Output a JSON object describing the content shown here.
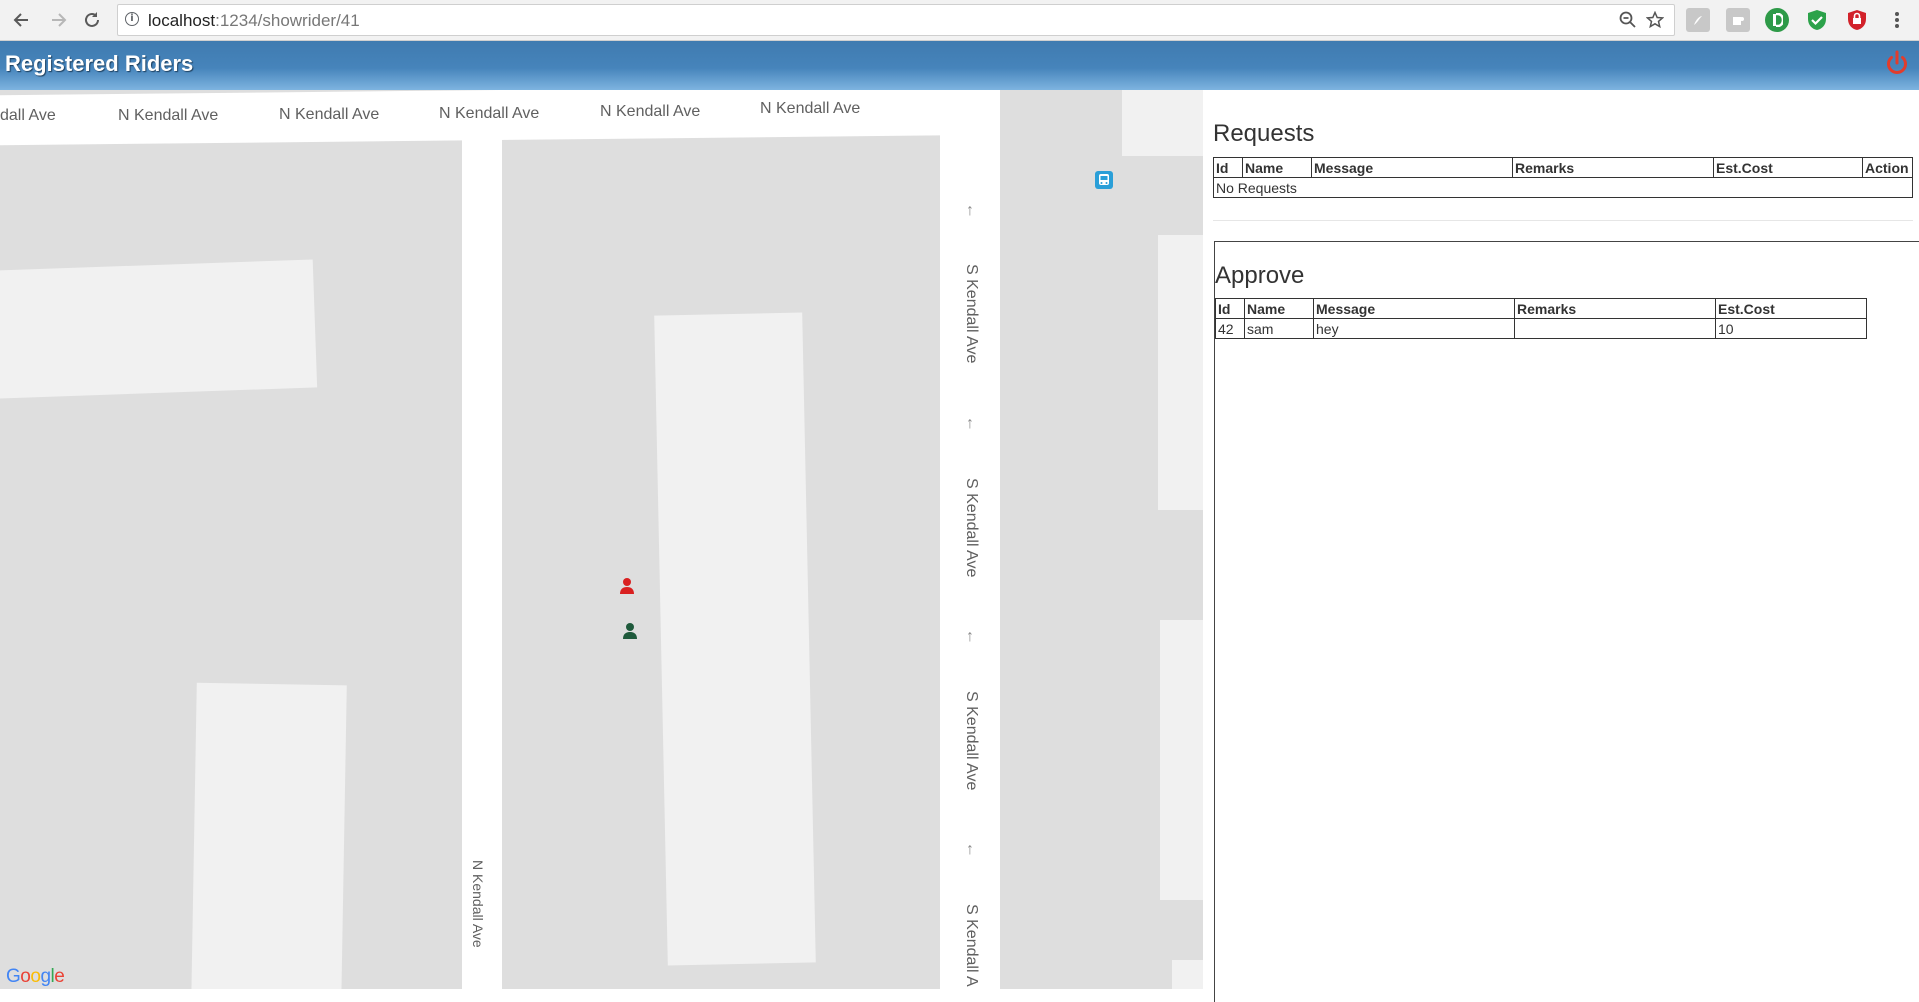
{
  "browser": {
    "url_host": "localhost",
    "url_path": ":1234/showrider/41",
    "icons": [
      "back-icon",
      "forward-icon",
      "reload-icon",
      "info-icon",
      "zoom-out-icon",
      "star-icon"
    ],
    "extensions": [
      "pdf-extension-icon",
      "puzzle-extension-icon",
      "readability-extension-icon",
      "shield-extension-icon",
      "adblock-extension-icon",
      "menu-icon"
    ],
    "colors": {
      "ext_green": "#2e9a48",
      "ext_shield": "#2ca24a",
      "ext_red": "#d2222a",
      "ext_gray": "#b7b7b7"
    }
  },
  "app": {
    "title": "Registered Riders",
    "power_icon": "power-icon",
    "colors": {
      "header_top": "#3f7bb0",
      "header_bottom": "#7eb4e0",
      "power": "#e23c2c"
    }
  },
  "map": {
    "street_top_labels": [
      "dall Ave",
      "N Kendall Ave",
      "N Kendall Ave",
      "N Kendall Ave",
      "N Kendall Ave",
      "N Kendall Ave"
    ],
    "street_right_labels": [
      "S Kendall Ave",
      "S Kendall Ave",
      "S Kendall Ave",
      "S Kendall A"
    ],
    "street_vertical_label": "N Kendall Ave",
    "markers": [
      "rider-marker-icon",
      "driver-marker-icon"
    ],
    "poi": "bus-stop-icon",
    "attribution_letters": [
      "G",
      "o",
      "o",
      "g",
      "l",
      "e"
    ],
    "attribution_colors": [
      "#4285f4",
      "#ea4335",
      "#fbbc05",
      "#4285f4",
      "#34a853",
      "#ea4335"
    ],
    "colors": {
      "background": "#dedede",
      "road": "#ffffff",
      "block": "#f1f1f1",
      "rider_marker": "#d92020",
      "driver_marker": "#1f5a3c"
    }
  },
  "requests": {
    "title": "Requests",
    "columns": [
      "Id",
      "Name",
      "Message",
      "Remarks",
      "Est.Cost",
      "Action"
    ],
    "empty_text": "No Requests"
  },
  "approve": {
    "title": "Approve",
    "columns": [
      "Id",
      "Name",
      "Message",
      "Remarks",
      "Est.Cost"
    ],
    "rows": [
      {
        "id": "42",
        "name": "sam",
        "message": "hey",
        "remarks": "",
        "cost": "10"
      }
    ]
  }
}
